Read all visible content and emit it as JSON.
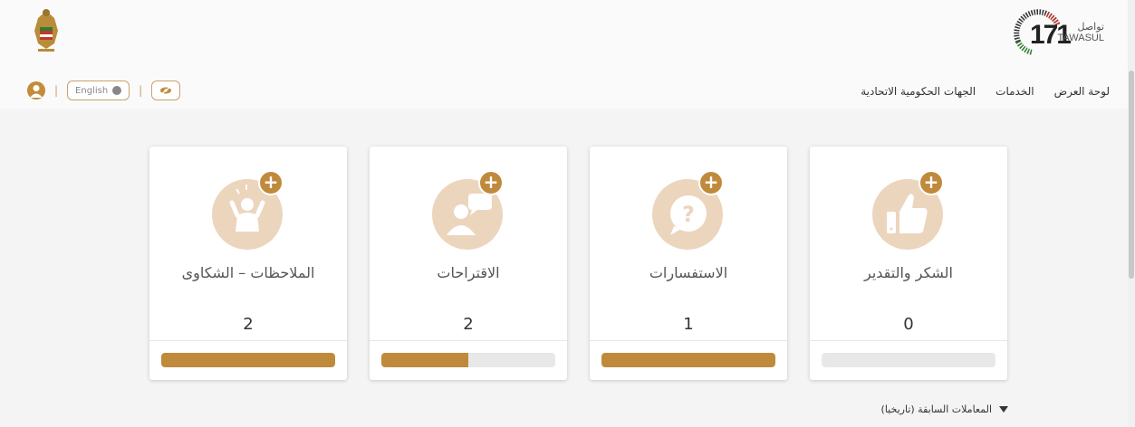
{
  "header": {
    "logo_name_ar": "تواصل",
    "logo_name_en": "TAWASUL",
    "logo_number": "171"
  },
  "nav": {
    "items": [
      {
        "label": "لوحة العرض"
      },
      {
        "label": "الخدمات"
      },
      {
        "label": "الجهات الحكومية الاتحادية"
      }
    ]
  },
  "tools": {
    "language_label": "English",
    "separator": "|"
  },
  "cards": [
    {
      "title": "الشكر والتقدير",
      "count": "0",
      "progress": 0,
      "icon": "thumbs-up-icon"
    },
    {
      "title": "الاستفسارات",
      "count": "1",
      "progress": 1.0,
      "icon": "question-bubble-icon"
    },
    {
      "title": "الاقتراحات",
      "count": "2",
      "progress": 0.5,
      "icon": "person-speech-icon"
    },
    {
      "title": "الملاحظات – الشكاوى",
      "count": "2",
      "progress": 1.0,
      "icon": "frustrated-person-icon"
    }
  ],
  "plus_symbol": "+",
  "history": {
    "label": "المعاملات السابقة (تاريخيا)",
    "icon": "filter-icon"
  },
  "colors": {
    "accent": "#c08a3c",
    "icon_bg": "#ecd5bd"
  }
}
